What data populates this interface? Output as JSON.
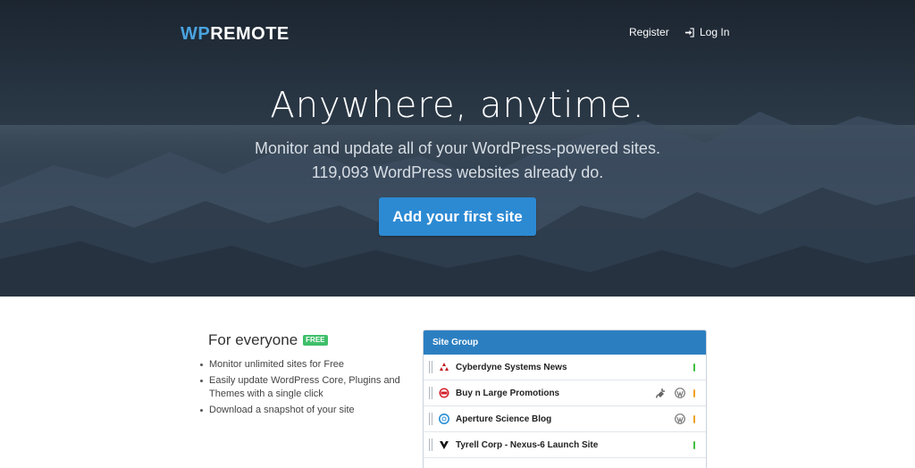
{
  "brand": {
    "logo_prefix": "WP",
    "logo_suffix": "REMOTE",
    "accent": "#4aa3df"
  },
  "nav": {
    "register": "Register",
    "login": "Log In"
  },
  "hero": {
    "headline": "Anywhere, anytime.",
    "subline1": "Monitor and update all of your WordPress-powered sites.",
    "subline2": "119,093 WordPress websites already do.",
    "cta": "Add your first site",
    "cta_color": "#2c8ad3"
  },
  "features": {
    "title": "For everyone",
    "badge": "FREE",
    "badge_color": "#3fbf6a",
    "items": [
      "Monitor unlimited sites for Free",
      "Easily update WordPress Core, Plugins and Themes with a single click",
      "Download a snapshot of your site"
    ]
  },
  "site_group": {
    "title": "Site Group",
    "header_color": "#2b7fc1",
    "rows": [
      {
        "name": "Cyberdyne Systems News",
        "icon": "cyberdyne-logo-icon",
        "status_color": "#3fbf3f",
        "tools": []
      },
      {
        "name": "Buy n Large Promotions",
        "icon": "buy-n-large-logo-icon",
        "status_color": "#f0a020",
        "tools": [
          "plugin-icon",
          "wordpress-icon"
        ]
      },
      {
        "name": "Aperture Science Blog",
        "icon": "aperture-logo-icon",
        "status_color": "#f0a020",
        "tools": [
          "wordpress-icon"
        ]
      },
      {
        "name": "Tyrell Corp - Nexus-6 Launch Site",
        "icon": "tyrell-logo-icon",
        "status_color": "#3fbf3f",
        "tools": []
      }
    ]
  }
}
